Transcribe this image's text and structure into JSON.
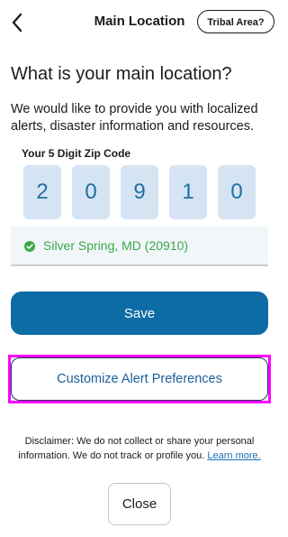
{
  "header": {
    "title": "Main Location",
    "tribal_button": "Tribal Area?",
    "back_icon": "chevron-left-icon"
  },
  "main": {
    "question": "What is your main location?",
    "description": "We would like to provide you with localized alerts, disaster information and resources.",
    "zip_label": "Your 5 Digit Zip Code",
    "zip_digits": [
      "2",
      "0",
      "9",
      "1",
      "0"
    ],
    "location": {
      "text": "Silver Spring, MD (20910)",
      "icon": "check-circle-icon",
      "color": "#3aa84a"
    }
  },
  "actions": {
    "save_label": "Save",
    "customize_label": "Customize Alert Preferences",
    "close_label": "Close"
  },
  "disclaimer": {
    "text": "Disclaimer: We do not collect or share your personal information. We do not track or profile you.",
    "link_text": "Learn more."
  },
  "colors": {
    "primary": "#0d6ba5",
    "zip_box_bg": "#d4e4f3",
    "highlight": "#ff00ff",
    "link": "#1a6fb5"
  }
}
